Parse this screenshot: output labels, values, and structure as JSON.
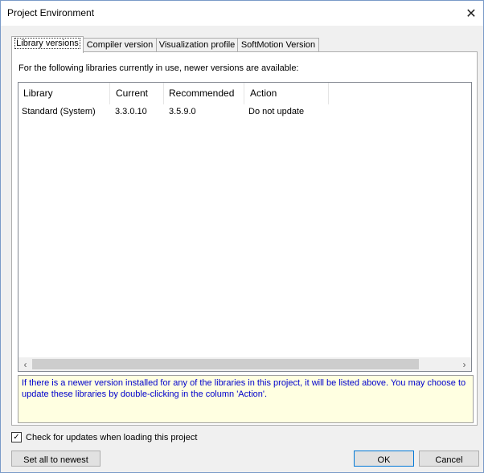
{
  "window": {
    "title": "Project Environment"
  },
  "tabs": [
    {
      "label": "Library versions"
    },
    {
      "label": "Compiler version"
    },
    {
      "label": "Visualization profile"
    },
    {
      "label": "SoftMotion Version"
    }
  ],
  "panel": {
    "info_text": "For the following libraries currently in use, newer versions are available:",
    "columns": [
      "Library",
      "Current",
      "Recommended",
      "Action"
    ],
    "rows": [
      {
        "library": "Standard (System)",
        "current": "3.3.0.10",
        "recommended": "3.5.9.0",
        "action": "Do not update"
      }
    ],
    "hint": "If there is a newer version installed for any of the libraries in this project, it will be listed above. You may choose to update these libraries by double-clicking in the column 'Action'."
  },
  "options": {
    "check_updates_label": "Check for updates when loading this project",
    "check_updates_checked": true
  },
  "buttons": {
    "set_all": "Set all to newest",
    "ok": "OK",
    "cancel": "Cancel"
  }
}
